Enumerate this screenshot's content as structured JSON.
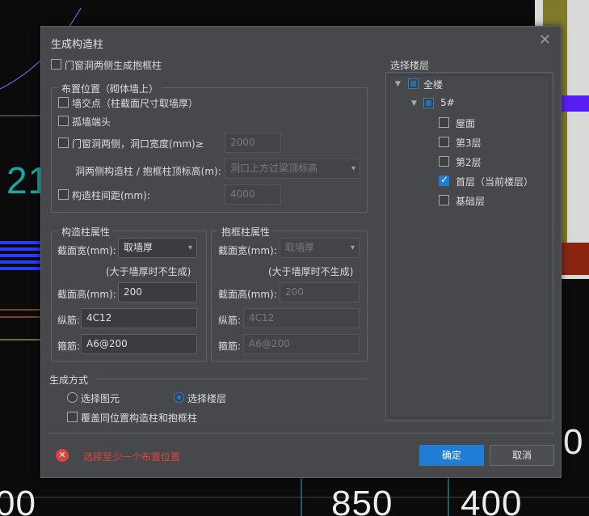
{
  "dialog": {
    "title": "生成构造柱",
    "close_symbol": "✕"
  },
  "top_option": {
    "label": "门窗洞两侧生成抱框柱",
    "checked": false
  },
  "placement": {
    "title": "布置位置（砌体墙上）",
    "wall_intersection": {
      "label": "墙交点（柱截面尺寸取墙厚）",
      "checked": false
    },
    "isolated_wall_end": {
      "label": "孤墙端头",
      "checked": false
    },
    "opening_sides": {
      "label": "门窗洞两侧，洞口宽度(mm)≥",
      "checked": false,
      "value": "2000"
    },
    "top_elevation": {
      "label": "洞两侧构造柱 / 抱框柱顶标高(m):",
      "value": "洞口上方过梁顶标高"
    },
    "spacing": {
      "label": "构造柱间距(mm):",
      "checked": false,
      "value": "4000"
    }
  },
  "column_props": {
    "title": "构造柱属性",
    "width_label": "截面宽(mm):",
    "width_value": "取墙厚",
    "width_note": "(大于墙厚时不生成)",
    "height_label": "截面高(mm):",
    "height_value": "200",
    "long_rebar_label": "纵筋:",
    "long_rebar_value": "4C12",
    "stirrup_label": "箍筋:",
    "stirrup_value": "A6@200"
  },
  "frame_props": {
    "title": "抱框柱属性",
    "width_label": "截面宽(mm):",
    "width_value": "取墙厚",
    "width_note": "(大于墙厚时不生成)",
    "height_label": "截面高(mm):",
    "height_value": "200",
    "long_rebar_label": "纵筋:",
    "long_rebar_value": "4C12",
    "stirrup_label": "箍筋:",
    "stirrup_value": "A6@200"
  },
  "generation": {
    "title": "生成方式",
    "option_element": {
      "label": "选择图元",
      "selected": false
    },
    "option_floor": {
      "label": "选择楼层",
      "selected": true
    },
    "overwrite": {
      "label": "覆盖同位置构造柱和抱框柱",
      "checked": false
    }
  },
  "floors": {
    "title": "选择楼层",
    "all": "全楼",
    "building": "5#",
    "items": [
      {
        "label": "屋面",
        "checked": false
      },
      {
        "label": "第3层",
        "checked": false
      },
      {
        "label": "第2层",
        "checked": false
      },
      {
        "label": "首层（当前楼层）",
        "checked": true
      },
      {
        "label": "基础层",
        "checked": false
      }
    ]
  },
  "footer": {
    "error_text": "选择至少一个布置位置",
    "ok_label": "确定",
    "cancel_label": "取消"
  },
  "background": {
    "left_number": "21",
    "bottom_numbers": [
      "00",
      "850",
      "400"
    ],
    "right_digit": "0"
  },
  "colors": {
    "accent": "#1f7ed3",
    "error": "#e0413e",
    "dialog_bg": "#47484b"
  }
}
